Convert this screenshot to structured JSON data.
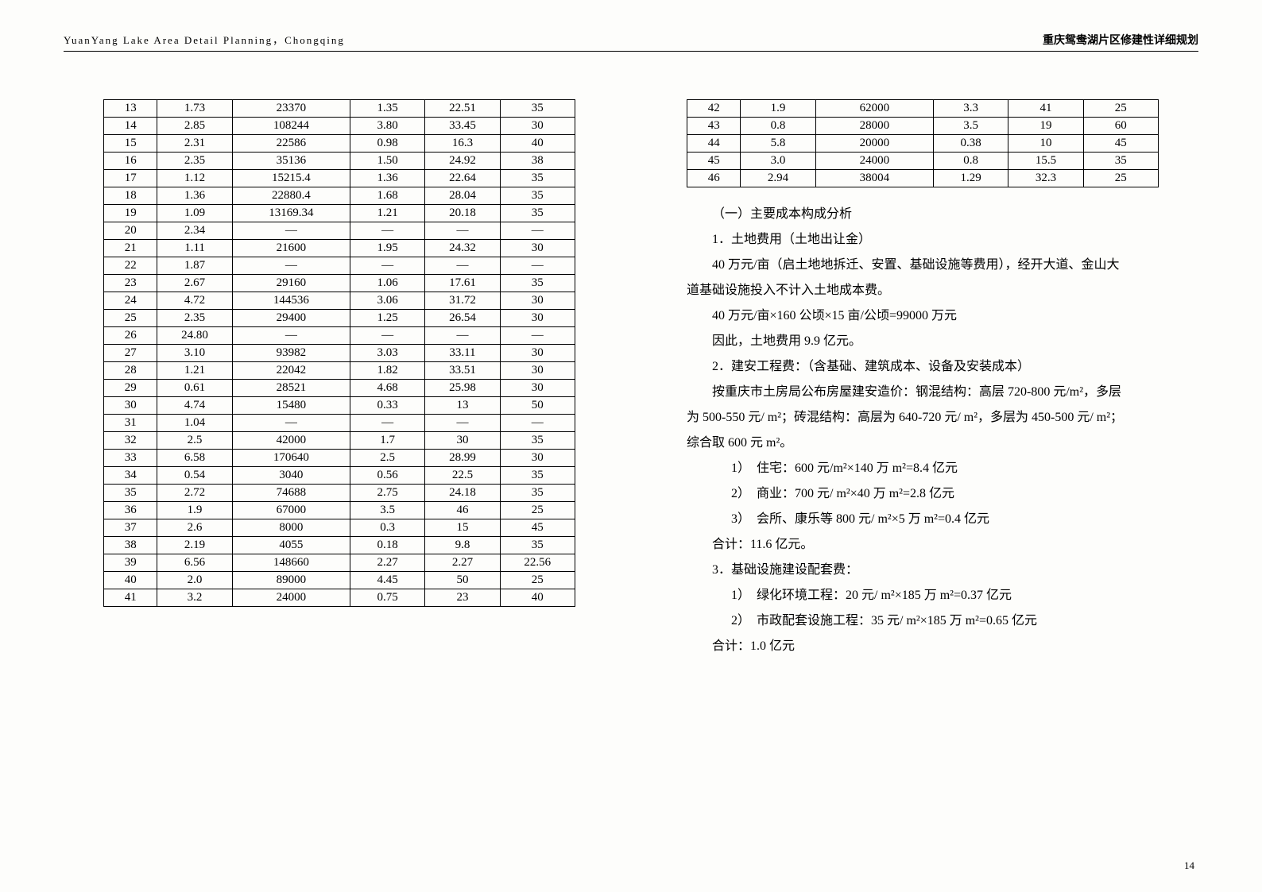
{
  "header": {
    "left": "YuanYang Lake Area Detail Planning，Chongqing",
    "right": "重庆鸳鸯湖片区修建性详细规划"
  },
  "page_number": "14",
  "table_left": {
    "rows": [
      [
        "13",
        "1.73",
        "23370",
        "1.35",
        "22.51",
        "35"
      ],
      [
        "14",
        "2.85",
        "108244",
        "3.80",
        "33.45",
        "30"
      ],
      [
        "15",
        "2.31",
        "22586",
        "0.98",
        "16.3",
        "40"
      ],
      [
        "16",
        "2.35",
        "35136",
        "1.50",
        "24.92",
        "38"
      ],
      [
        "17",
        "1.12",
        "15215.4",
        "1.36",
        "22.64",
        "35"
      ],
      [
        "18",
        "1.36",
        "22880.4",
        "1.68",
        "28.04",
        "35"
      ],
      [
        "19",
        "1.09",
        "13169.34",
        "1.21",
        "20.18",
        "35"
      ],
      [
        "20",
        "2.34",
        "—",
        "—",
        "—",
        "—"
      ],
      [
        "21",
        "1.11",
        "21600",
        "1.95",
        "24.32",
        "30"
      ],
      [
        "22",
        "1.87",
        "—",
        "—",
        "—",
        "—"
      ],
      [
        "23",
        "2.67",
        "29160",
        "1.06",
        "17.61",
        "35"
      ],
      [
        "24",
        "4.72",
        "144536",
        "3.06",
        "31.72",
        "30"
      ],
      [
        "25",
        "2.35",
        "29400",
        "1.25",
        "26.54",
        "30"
      ],
      [
        "26",
        "24.80",
        "—",
        "—",
        "—",
        "—"
      ],
      [
        "27",
        "3.10",
        "93982",
        "3.03",
        "33.11",
        "30"
      ],
      [
        "28",
        "1.21",
        "22042",
        "1.82",
        "33.51",
        "30"
      ],
      [
        "29",
        "0.61",
        "28521",
        "4.68",
        "25.98",
        "30"
      ],
      [
        "30",
        "4.74",
        "15480",
        "0.33",
        "13",
        "50"
      ],
      [
        "31",
        "1.04",
        "—",
        "—",
        "—",
        "—"
      ],
      [
        "32",
        "2.5",
        "42000",
        "1.7",
        "30",
        "35"
      ],
      [
        "33",
        "6.58",
        "170640",
        "2.5",
        "28.99",
        "30"
      ],
      [
        "34",
        "0.54",
        "3040",
        "0.56",
        "22.5",
        "35"
      ],
      [
        "35",
        "2.72",
        "74688",
        "2.75",
        "24.18",
        "35"
      ],
      [
        "36",
        "1.9",
        "67000",
        "3.5",
        "46",
        "25"
      ],
      [
        "37",
        "2.6",
        "8000",
        "0.3",
        "15",
        "45"
      ],
      [
        "38",
        "2.19",
        "4055",
        "0.18",
        "9.8",
        "35"
      ],
      [
        "39",
        "6.56",
        "148660",
        "2.27",
        "2.27",
        "22.56"
      ],
      [
        "40",
        "2.0",
        "89000",
        "4.45",
        "50",
        "25"
      ],
      [
        "41",
        "3.2",
        "24000",
        "0.75",
        "23",
        "40"
      ]
    ]
  },
  "table_right": {
    "rows": [
      [
        "42",
        "1.9",
        "62000",
        "3.3",
        "41",
        "25"
      ],
      [
        "43",
        "0.8",
        "28000",
        "3.5",
        "19",
        "60"
      ],
      [
        "44",
        "5.8",
        "20000",
        "0.38",
        "10",
        "45"
      ],
      [
        "45",
        "3.0",
        "24000",
        "0.8",
        "15.5",
        "35"
      ],
      [
        "46",
        "2.94",
        "38004",
        "1.29",
        "32.3",
        "25"
      ]
    ]
  },
  "text": {
    "h1": "（一）主要成本构成分析",
    "p1": "1．土地费用（土地出让金）",
    "p2a": "40 万元/亩（启土地地拆迁、安置、基础设施等费用），经开大道、金山大",
    "p2b": "道基础设施投入不计入土地成本费。",
    "p3": "40 万元/亩×160 公顷×15 亩/公顷=99000 万元",
    "p4": "因此，土地费用 9.9 亿元。",
    "p5": "2．建安工程费：（含基础、建筑成本、设备及安装成本）",
    "p6a": "按重庆市土房局公布房屋建安造价：钢混结构：高层 720-800 元/m²，多层",
    "p6b": "为 500-550 元/ m²；砖混结构：高层为 640-720 元/ m²，多层为 450-500 元/ m²；",
    "p6c": "综合取 600 元 m²。",
    "li1": "1）　住宅：600 元/m²×140 万 m²=8.4 亿元",
    "li2": "2）　商业：700 元/ m²×40 万 m²=2.8 亿元",
    "li3": "3）　会所、康乐等 800 元/ m²×5 万 m²=0.4 亿元",
    "p7": "合计：11.6 亿元。",
    "p8": "3．基础设施建设配套费：",
    "li4": "1）　绿化环境工程：20 元/ m²×185 万 m²=0.37 亿元",
    "li5": "2）　市政配套设施工程：35 元/ m²×185 万 m²=0.65 亿元",
    "p9": "合计：1.0 亿元"
  }
}
